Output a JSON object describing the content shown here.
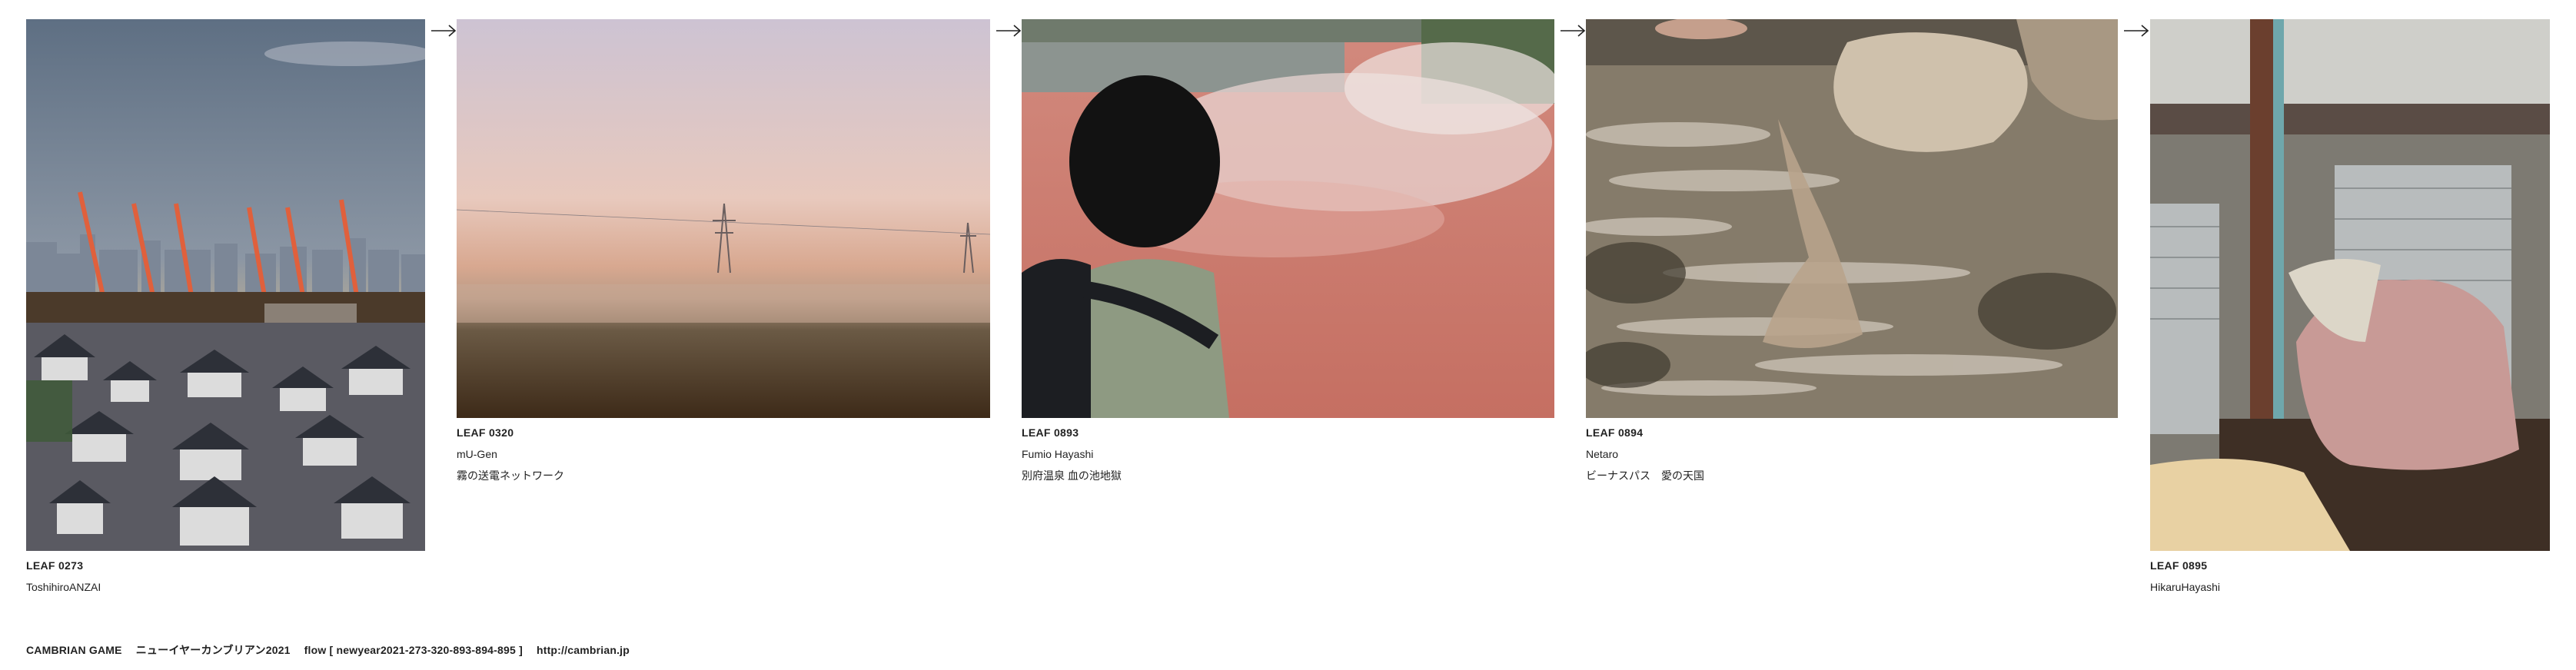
{
  "leaves": [
    {
      "id": "LEAF 0273",
      "author": "ToshihiroANZAI",
      "title": "",
      "image": "city-skyline-cranes"
    },
    {
      "id": "LEAF 0320",
      "author": "mU-Gen",
      "title": "霧の送電ネットワーク",
      "image": "misty-field-pylons"
    },
    {
      "id": "LEAF 0893",
      "author": "Fumio Hayashi",
      "title": "別府温泉 血の池地獄",
      "image": "red-hot-spring-person"
    },
    {
      "id": "LEAF 0894",
      "author": "Netaro",
      "title": "ビーナスパス　愛の天国",
      "image": "water-reflection-rocks"
    },
    {
      "id": "LEAF 0895",
      "author": "HikaruHayashi",
      "title": "",
      "image": "shutter-storefront-bags"
    }
  ],
  "arrow_icon": "arrow-right-icon",
  "footer": {
    "game": "CAMBRIAN GAME",
    "event": "ニューイヤーカンブリアン2021",
    "flow": "flow [ newyear2021-273-320-893-894-895 ]",
    "url": "http://cambrian.jp"
  }
}
